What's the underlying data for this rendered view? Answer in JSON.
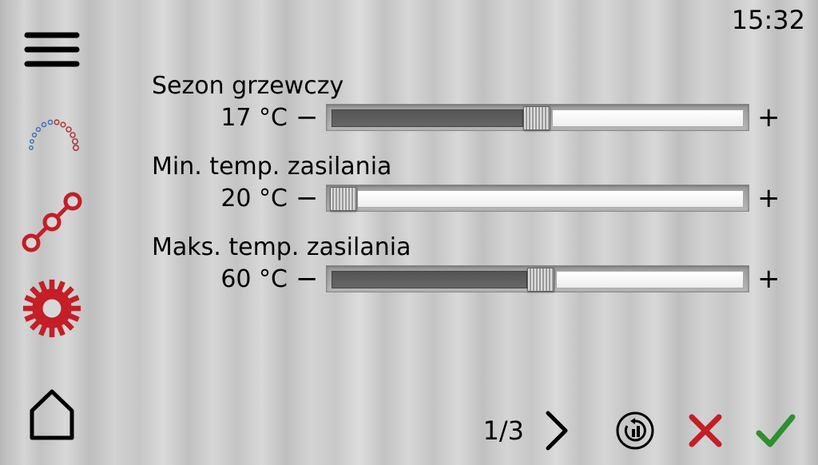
{
  "clock": "15:32",
  "settings": [
    {
      "label": "Sezon grzewczy",
      "value": "17 °C",
      "percent": 47
    },
    {
      "label": "Min. temp. zasilania",
      "value": "20 °C",
      "percent": 0
    },
    {
      "label": "Maks. temp. zasilania",
      "value": "60 °C",
      "percent": 48
    }
  ],
  "pager": {
    "current": 1,
    "total": 3,
    "display": "1/3"
  },
  "glyphs": {
    "minus": "−",
    "plus": "+"
  },
  "colors": {
    "accent_red": "#c41e26",
    "ok_green": "#2f8f2f"
  }
}
